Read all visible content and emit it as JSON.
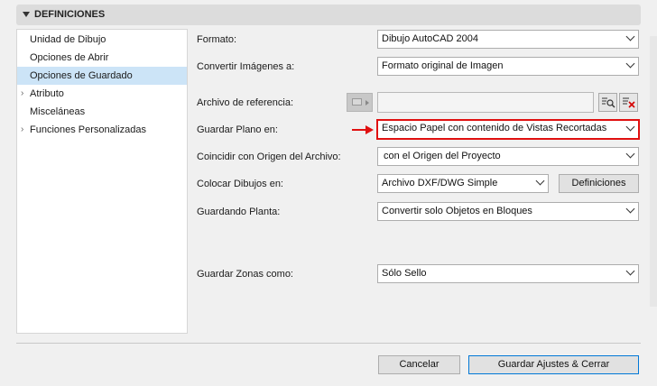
{
  "panel": {
    "title": "DEFINICIONES"
  },
  "nav": {
    "items": [
      {
        "label": "Unidad de Dibujo",
        "expandable": false,
        "selected": false
      },
      {
        "label": "Opciones de Abrir",
        "expandable": false,
        "selected": false
      },
      {
        "label": "Opciones de Guardado",
        "expandable": false,
        "selected": true
      },
      {
        "label": "Atributo",
        "expandable": true,
        "selected": false
      },
      {
        "label": "Misceláneas",
        "expandable": false,
        "selected": false
      },
      {
        "label": "Funciones Personalizadas",
        "expandable": true,
        "selected": false
      }
    ]
  },
  "form": {
    "formato": {
      "label": "Formato:",
      "value": "Dibujo AutoCAD 2004"
    },
    "convertir_imagenes": {
      "label": "Convertir Imágenes a:",
      "value": "Formato original de Imagen"
    },
    "archivo_referencia": {
      "label": "Archivo de referencia:",
      "value": ""
    },
    "guardar_plano": {
      "label": "Guardar Plano en:",
      "value": "Espacio Papel con contenido de Vistas Recortadas"
    },
    "coincidir_origen": {
      "label": "Coincidir con Origen del Archivo:",
      "value": "con el Origen del Proyecto"
    },
    "colocar_dibujos": {
      "label": "Colocar Dibujos en:",
      "value": "Archivo DXF/DWG Simple",
      "button": "Definiciones"
    },
    "guardando_planta": {
      "label": "Guardando Planta:",
      "value": "Convertir solo Objetos en Bloques"
    },
    "guardar_zonas": {
      "label": "Guardar Zonas como:",
      "value": "Sólo Sello"
    }
  },
  "footer": {
    "cancel": "Cancelar",
    "save": "Guardar Ajustes & Cerrar"
  },
  "colors": {
    "accent": "#0078d7",
    "highlight": "#e01010",
    "selected_nav": "#cce4f7"
  }
}
